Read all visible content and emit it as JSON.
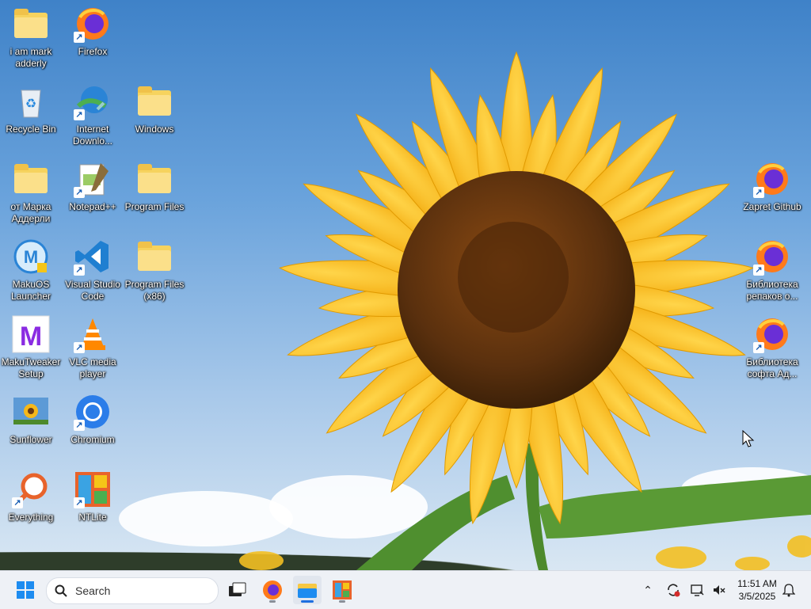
{
  "desktop": {
    "wallpaper": "Sunflower",
    "icons": [
      {
        "label": "i am mark adderly",
        "icon": "folder-icon"
      },
      {
        "label": "Firefox",
        "icon": "firefox-icon"
      },
      {
        "label": "Recycle Bin",
        "icon": "recycle-bin-icon"
      },
      {
        "label": "Internet Downlo...",
        "icon": "internet-download-manager-icon"
      },
      {
        "label": "Windows",
        "icon": "folder-icon"
      },
      {
        "label": "от Марка Аддерли",
        "icon": "folder-icon"
      },
      {
        "label": "Notepad++",
        "icon": "notepad-plus-plus-icon"
      },
      {
        "label": "Program Files",
        "icon": "folder-icon"
      },
      {
        "label": "MakuOS Launcher",
        "icon": "makuos-launcher-icon"
      },
      {
        "label": "Visual Studio Code",
        "icon": "vscode-icon"
      },
      {
        "label": "Program Files (x86)",
        "icon": "folder-icon"
      },
      {
        "label": "MakuTweaker Setup",
        "icon": "makutweaker-icon"
      },
      {
        "label": "VLC media player",
        "icon": "vlc-icon"
      },
      {
        "label": "Sunflower",
        "icon": "image-file-icon"
      },
      {
        "label": "Chromium",
        "icon": "chromium-icon"
      },
      {
        "label": "Everything",
        "icon": "everything-search-icon"
      },
      {
        "label": "NTLite",
        "icon": "ntlite-icon"
      },
      {
        "label": "Zapret Github",
        "icon": "firefox-icon"
      },
      {
        "label": "Библиотека репаков о...",
        "icon": "firefox-icon"
      },
      {
        "label": "Библиотека софта Ад...",
        "icon": "firefox-icon"
      }
    ]
  },
  "taskbar": {
    "search_placeholder": "Search",
    "apps": [
      {
        "name": "Start",
        "icon": "windows-logo-icon"
      },
      {
        "name": "Task View",
        "icon": "task-view-icon"
      },
      {
        "name": "Firefox",
        "icon": "firefox-icon"
      },
      {
        "name": "File Explorer",
        "icon": "file-explorer-icon"
      },
      {
        "name": "NTLite",
        "icon": "ntlite-icon"
      }
    ],
    "tray": {
      "time": "11:51 AM",
      "date": "3/5/2025"
    }
  },
  "colors": {
    "sky": "#5c9ad6",
    "petal": "#f6b81a",
    "center": "#6b3a12",
    "taskbar": "#eef1f6",
    "accent": "#1d6fe0"
  }
}
